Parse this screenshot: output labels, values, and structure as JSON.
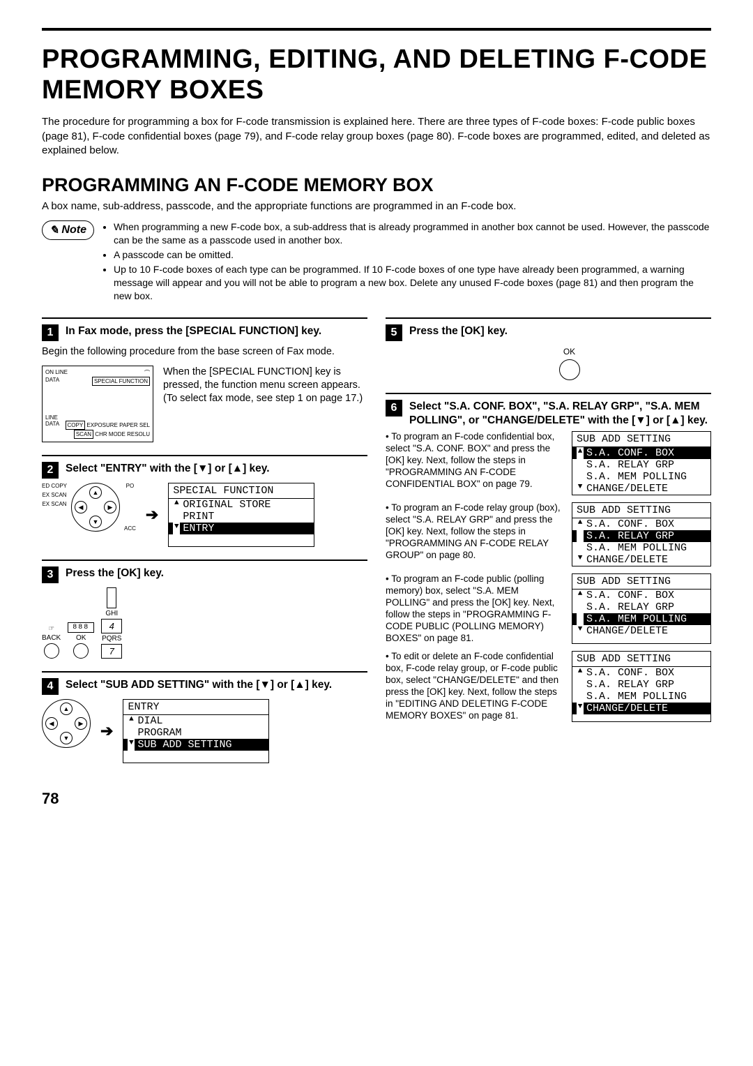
{
  "page_number": "78",
  "title": "PROGRAMMING, EDITING, AND DELETING F-CODE MEMORY BOXES",
  "intro": "The procedure for programming a box for F-code transmission is explained here. There are three types of F-code boxes: F-code public boxes (page 81), F-code confidential boxes (page 79), and F-code relay group boxes (page 80). F-code boxes are programmed, edited, and deleted as explained below.",
  "section_title": "PROGRAMMING AN F-CODE MEMORY BOX",
  "section_intro": "A box name, sub-address, passcode, and the appropriate functions are programmed in an F-code box.",
  "note_label": "Note",
  "notes": [
    "When programming a new F-code box, a sub-address that is already programmed in another box cannot be used. However, the passcode can be the same as a passcode used in another box.",
    "A passcode can be omitted.",
    "Up to 10 F-code boxes of each type can be programmed. If 10 F-code boxes of one type have already been programmed, a warning message will appear and you will not be able to program a new box. Delete any unused F-code boxes (page 81) and then program the new box."
  ],
  "steps": {
    "s1": {
      "num": "1",
      "title": "In Fax mode, press the [SPECIAL FUNCTION] key.",
      "pre": "Begin the following procedure from the base screen of Fax mode.",
      "body": "When the [SPECIAL FUNCTION] key is pressed, the function menu screen appears. (To select fax mode, see step 1 on page 17.)",
      "panel": {
        "labels": [
          "ON LINE",
          "DATA",
          "SPECIAL FUNCTION",
          "LINE",
          "DATA",
          "COPY",
          "SCAN",
          "EXPOSURE",
          "PAPER SEL",
          "CHR MODE",
          "RESOLU"
        ]
      }
    },
    "s2": {
      "num": "2",
      "title": "Select \"ENTRY\" with the [▼] or [▲] key.",
      "lcd_title": "SPECIAL FUNCTION",
      "lcd_lines": [
        "ORIGINAL STORE",
        "PRINT",
        "ENTRY"
      ],
      "lcd_selected_index": 2,
      "side_labels": [
        "ED COPY",
        "EX SCAN",
        "EX SCAN",
        "ACC"
      ]
    },
    "s3": {
      "num": "3",
      "title": "Press the [OK] key.",
      "ok_labels": {
        "back": "BACK",
        "ok": "OK",
        "seg": "888",
        "ghi": "GHI",
        "pqrs": "PQRS",
        "k4": "4",
        "k7": "7"
      }
    },
    "s4": {
      "num": "4",
      "title": "Select \"SUB ADD SETTING\" with the [▼] or [▲] key.",
      "lcd_title": "ENTRY",
      "lcd_lines": [
        "DIAL",
        "PROGRAM",
        "SUB ADD SETTING"
      ],
      "lcd_selected_index": 2
    },
    "s5": {
      "num": "5",
      "title": "Press the [OK] key.",
      "ok_label": "OK"
    },
    "s6": {
      "num": "6",
      "title": "Select \"S.A. CONF. BOX\", \"S.A. RELAY GRP\", \"S.A. MEM POLLING\", or \"CHANGE/DELETE\" with the [▼] or [▲] key.",
      "options_title": "SUB ADD SETTING",
      "options": [
        "S.A. CONF. BOX",
        "S.A. RELAY GRP",
        "S.A. MEM POLLING",
        "CHANGE/DELETE"
      ],
      "variants": [
        {
          "selected": 0,
          "text": "To program an F-code confidential box, select \"S.A. CONF. BOX\" and press the [OK] key. Next, follow the steps in \"PROGRAMMING AN F-CODE CONFIDENTIAL BOX\" on page 79."
        },
        {
          "selected": 1,
          "text": "To program an F-code relay group (box), select \"S.A. RELAY GRP\" and press the [OK] key. Next, follow the steps in \"PROGRAMMING AN F-CODE RELAY GROUP\" on page 80."
        },
        {
          "selected": 2,
          "text": "To program an F-code public (polling memory) box, select \"S.A. MEM POLLING\" and press the [OK] key. Next, follow the steps in \"PROGRAMMING F-CODE PUBLIC (POLLING MEMORY) BOXES\" on page 81."
        },
        {
          "selected": 3,
          "text": "To edit or delete an F-code confidential box, F-code relay group, or F-code public box, select \"CHANGE/DELETE\" and then press the [OK] key. Next, follow the steps in \"EDITING AND DELETING F-CODE MEMORY BOXES\" on page 81."
        }
      ]
    }
  }
}
